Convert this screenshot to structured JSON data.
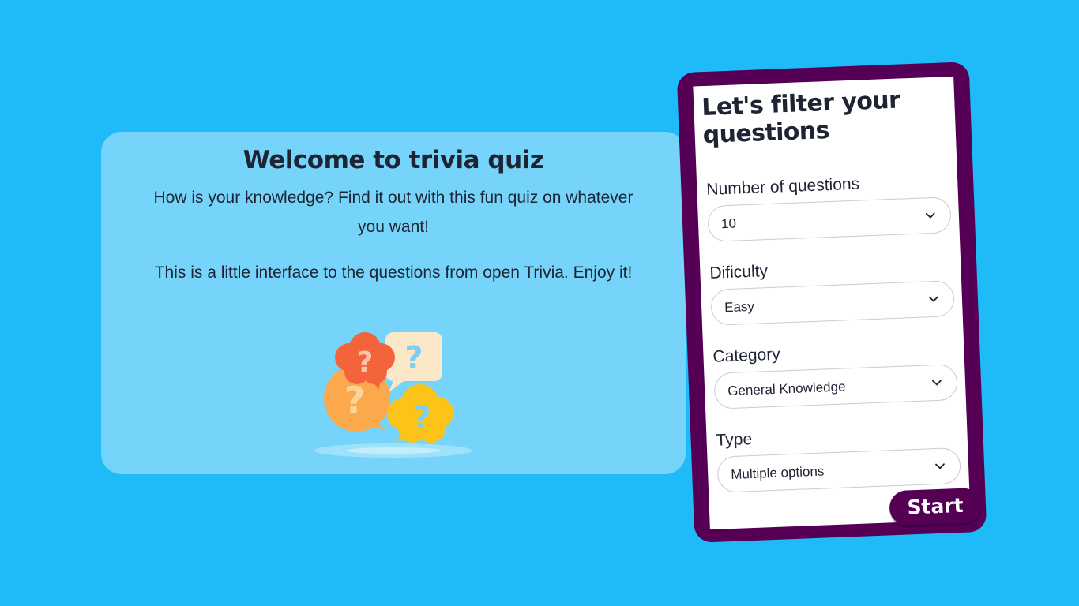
{
  "welcome": {
    "title": "Welcome to trivia quiz",
    "paragraph1": "How is your knowledge? Find it out with this fun quiz on whatever you want!",
    "paragraph2": "This is a little interface to the questions from open Trivia. Enjoy it!",
    "illustration_icon": "question-bubbles-icon"
  },
  "filter": {
    "title": "Let's filter your questions",
    "fields": [
      {
        "label": "Number of questions",
        "value": "10"
      },
      {
        "label": "Dificulty",
        "value": "Easy"
      },
      {
        "label": "Category",
        "value": "General Knowledge"
      },
      {
        "label": "Type",
        "value": "Multiple options"
      }
    ],
    "start_label": "Start"
  },
  "colors": {
    "background": "#1fbbf8",
    "welcome_card": "#76d4fb",
    "filter_frame": "#560055",
    "text": "#1e2433"
  }
}
